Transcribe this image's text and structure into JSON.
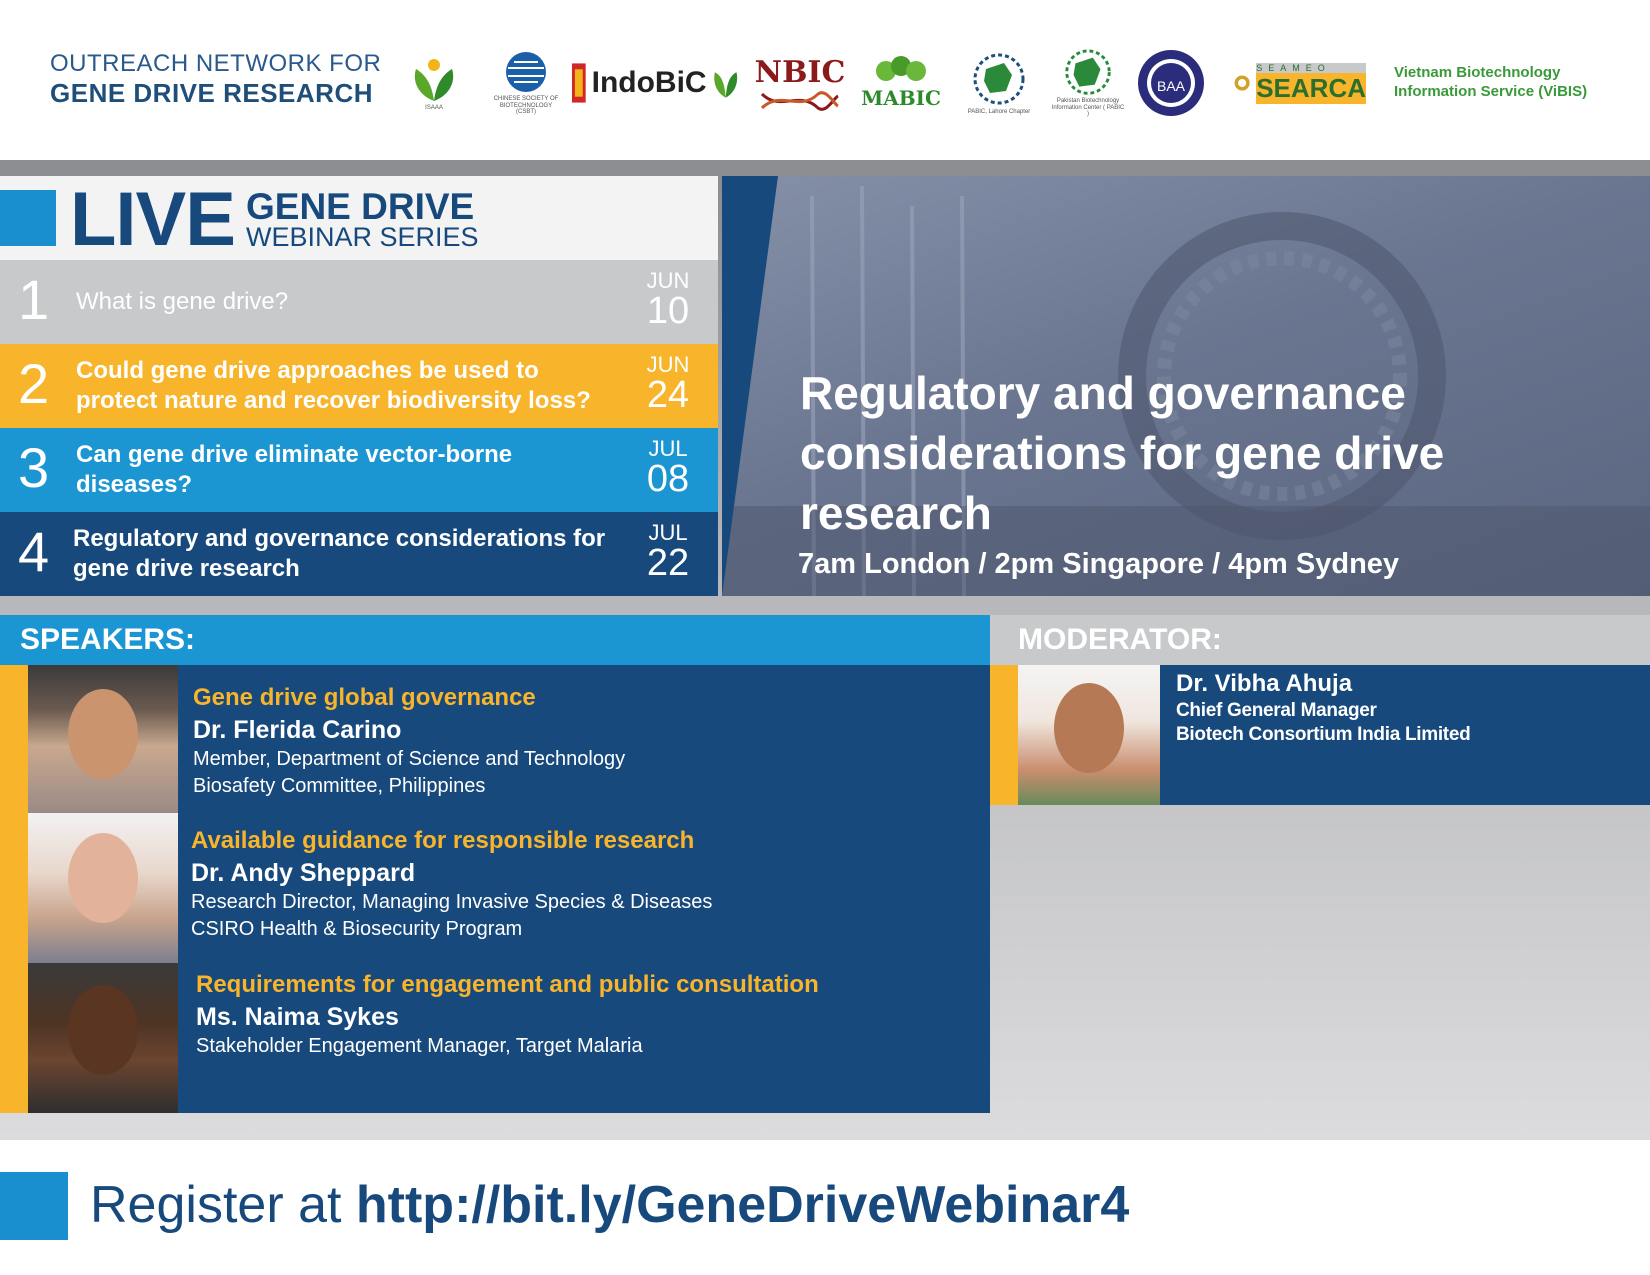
{
  "header": {
    "org_line1": "OUTREACH NETWORK FOR",
    "org_line2": "GENE DRIVE RESEARCH",
    "logos": {
      "isaaa": "ISAAA",
      "csbt": "CHINESE SOCIETY OF BIOTECHNOLOGY (CSBT)",
      "indobic": "IndoBiC",
      "indobic_sub": "ISAAA",
      "nbic": "NBIC",
      "mabic": "MABIC",
      "pabic_lahore": "PABIC, Lahore Chapter",
      "pabic": "Pakistan Biotechnology Information Center ( PABIC )",
      "baa": "BAA",
      "searca_top": "SEAMEO",
      "searca": "SEARCA"
    },
    "vibis_line1": "Vietnam Biotechnology",
    "vibis_line2": "Information Service (ViBIS)"
  },
  "series": {
    "live": "LIVE",
    "gene_drive": "GENE DRIVE",
    "webinar_series": "WEBINAR SERIES"
  },
  "sessions": [
    {
      "num": "1",
      "title": "What is gene drive?",
      "month": "JUN",
      "day": "10"
    },
    {
      "num": "2",
      "title": "Could gene drive approaches be used to protect nature and recover biodiversity loss?",
      "month": "JUN",
      "day": "24"
    },
    {
      "num": "3",
      "title": "Can gene drive eliminate vector-borne diseases?",
      "month": "JUL",
      "day": "08"
    },
    {
      "num": "4",
      "title": "Regulatory and governance considerations for gene drive research",
      "month": "JUL",
      "day": "22"
    }
  ],
  "hero": {
    "title": "Regulatory and governance considerations for gene drive research",
    "time": "7am London / 2pm Singapore / 4pm Sydney"
  },
  "speakers_label": "SPEAKERS:",
  "moderator_label": "MODERATOR:",
  "speakers": [
    {
      "topic": "Gene drive global governance",
      "name": "Dr. Flerida Carino",
      "role1": "Member, Department of Science and Technology",
      "role2": "Biosafety Committee, Philippines"
    },
    {
      "topic": "Available guidance for responsible research",
      "name": "Dr. Andy Sheppard",
      "role1": "Research Director, Managing Invasive Species & Diseases",
      "role2": "CSIRO Health & Biosecurity Program"
    },
    {
      "topic": "Requirements for engagement and public consultation",
      "name": "Ms. Naima Sykes",
      "role1": "Stakeholder Engagement Manager, Target Malaria"
    }
  ],
  "moderator": {
    "name": "Dr. Vibha Ahuja",
    "role1": "Chief General Manager",
    "role2": "Biotech Consortium India Limited"
  },
  "register": {
    "prefix": "Register at",
    "url": "http://bit.ly/GeneDriveWebinar4"
  },
  "colors": {
    "navy": "#17497c",
    "blue": "#1b96d3",
    "orange": "#f8b42a",
    "gray": "#c8c9cb"
  }
}
